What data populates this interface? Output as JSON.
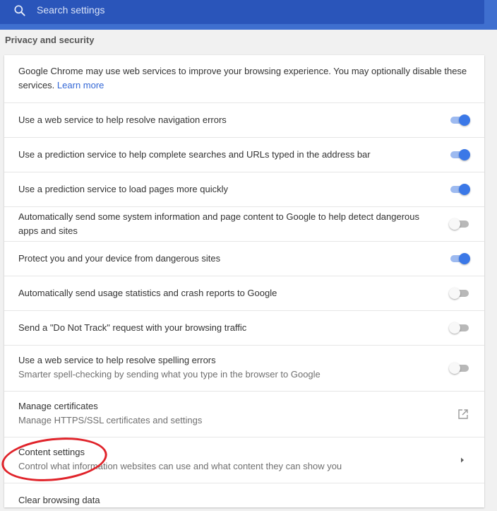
{
  "search": {
    "placeholder": "Search settings"
  },
  "section_title": "Privacy and security",
  "intro": {
    "text": "Google Chrome may use web services to improve your browsing experience. You may optionally disable these services.",
    "link": "Learn more"
  },
  "settings": [
    {
      "label": "Use a web service to help resolve navigation errors",
      "enabled": true
    },
    {
      "label": "Use a prediction service to help complete searches and URLs typed in the address bar",
      "enabled": true
    },
    {
      "label": "Use a prediction service to load pages more quickly",
      "enabled": true
    },
    {
      "label": "Automatically send some system information and page content to Google to help detect dangerous apps and sites",
      "enabled": false
    },
    {
      "label": "Protect you and your device from dangerous sites",
      "enabled": true
    },
    {
      "label": "Automatically send usage statistics and crash reports to Google",
      "enabled": false
    },
    {
      "label": "Send a \"Do Not Track\" request with your browsing traffic",
      "enabled": false
    },
    {
      "label": "Use a web service to help resolve spelling errors",
      "sublabel": "Smarter spell-checking by sending what you type in the browser to Google",
      "enabled": false
    }
  ],
  "manage_certificates": {
    "label": "Manage certificates",
    "sublabel": "Manage HTTPS/SSL certificates and settings",
    "icon": "open-in-new-icon"
  },
  "content_settings": {
    "label": "Content settings",
    "sublabel": "Control what information websites can use and what content they can show you",
    "icon": "arrow-right-icon"
  },
  "clear_browsing_data": {
    "label": "Clear browsing data"
  },
  "colors": {
    "header": "#3f6fcf",
    "search_bg": "#2a55ba",
    "toggle_on": "#3b78e7",
    "link": "#3367d6",
    "annotation": "#e0232a"
  }
}
